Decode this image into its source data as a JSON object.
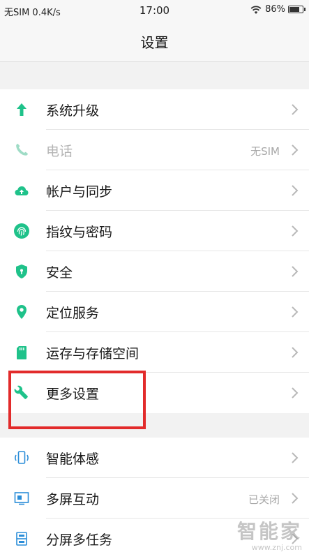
{
  "status": {
    "left": "无SIM 0.4K/s",
    "time": "17:00",
    "battery": "86%",
    "battery_level": 0.86
  },
  "title": "设置",
  "group1": [
    {
      "label": "系统升级",
      "icon": "arrow-up-icon",
      "value": ""
    },
    {
      "label": "电话",
      "icon": "phone-icon",
      "value": "无SIM",
      "disabled": true
    },
    {
      "label": "帐户与同步",
      "icon": "cloud-sync-icon",
      "value": ""
    },
    {
      "label": "指纹与密码",
      "icon": "fingerprint-icon",
      "value": ""
    },
    {
      "label": "安全",
      "icon": "shield-icon",
      "value": ""
    },
    {
      "label": "定位服务",
      "icon": "location-pin-icon",
      "value": ""
    },
    {
      "label": "运存与存储空间",
      "icon": "sd-card-icon",
      "value": ""
    },
    {
      "label": "更多设置",
      "icon": "wrench-icon",
      "value": ""
    }
  ],
  "group2": [
    {
      "label": "智能体感",
      "icon": "phone-gesture-icon",
      "value": ""
    },
    {
      "label": "多屏互动",
      "icon": "screen-cast-icon",
      "value": "已关闭"
    },
    {
      "label": "分屏多任务",
      "icon": "split-screen-icon",
      "value": ""
    }
  ],
  "watermark": {
    "main": "智能家",
    "url": "www.znj.com"
  },
  "colors": {
    "accent": "#1fc28a",
    "highlight": "#e22b2b"
  }
}
